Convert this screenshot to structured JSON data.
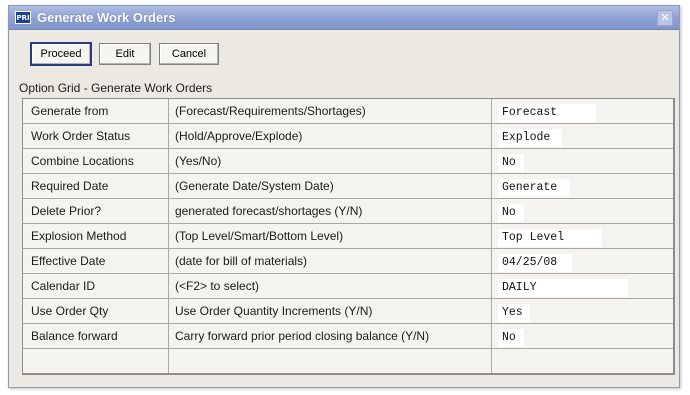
{
  "window": {
    "title": "Generate Work Orders",
    "icon": "app-icon"
  },
  "toolbar": {
    "proceed_label": "Proceed",
    "edit_label": "Edit",
    "cancel_label": "Cancel"
  },
  "grid": {
    "caption": "Option Grid - Generate Work Orders",
    "rows": [
      {
        "option": "Generate from",
        "description": "(Forecast/Requirements/Shortages)",
        "value": "Forecast"
      },
      {
        "option": "Work Order Status",
        "description": "(Hold/Approve/Explode)",
        "value": "Explode"
      },
      {
        "option": "Combine Locations",
        "description": "(Yes/No)",
        "value": "No"
      },
      {
        "option": "Required Date",
        "description": "(Generate Date/System Date)",
        "value": "Generate"
      },
      {
        "option": "Delete Prior?",
        "description": "generated forecast/shortages (Y/N)",
        "value": "No"
      },
      {
        "option": "Explosion Method",
        "description": "(Top Level/Smart/Bottom Level)",
        "value": "Top Level"
      },
      {
        "option": "Effective Date",
        "description": "(date for bill of materials)",
        "value": "04/25/08"
      },
      {
        "option": "Calendar ID",
        "description": "(<F2> to select)",
        "value": "DAILY"
      },
      {
        "option": "Use Order Qty",
        "description": "Use Order Quantity Increments (Y/N)",
        "value": "Yes"
      },
      {
        "option": "Balance forward",
        "description": "Carry forward prior period closing balance (Y/N)",
        "value": "No"
      },
      {
        "option": "",
        "description": "",
        "value": ""
      }
    ]
  }
}
